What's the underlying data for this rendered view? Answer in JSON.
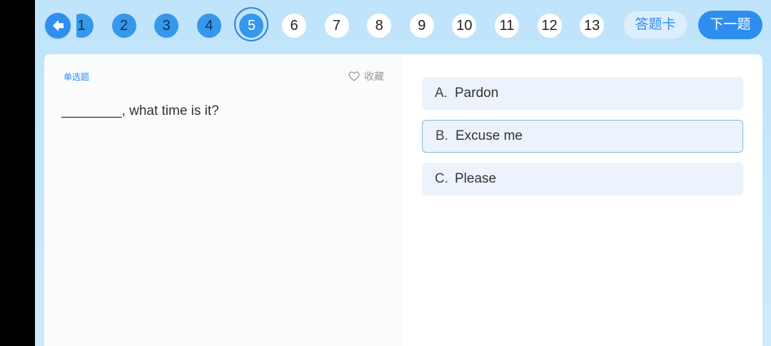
{
  "nav": {
    "back_icon": "arrow-left-icon",
    "question_numbers": [
      "1",
      "2",
      "3",
      "4",
      "5",
      "6",
      "7",
      "8",
      "9",
      "10",
      "11",
      "12",
      "13"
    ],
    "current_question": "5",
    "answered_questions": [
      "1",
      "2",
      "3",
      "4"
    ],
    "answer_card_label": "答题卡",
    "next_label": "下一题"
  },
  "question": {
    "type_label": "单选题",
    "favorite_label": "收藏",
    "text": "________, what time is it?",
    "options": [
      {
        "letter": "A.",
        "text": "Pardon",
        "selected": false
      },
      {
        "letter": "B.",
        "text": "Excuse me",
        "selected": true
      },
      {
        "letter": "C.",
        "text": "Please",
        "selected": false
      }
    ]
  },
  "colors": {
    "accent": "#2e8ef0",
    "answered": "#3797ea",
    "option_bg": "#edf3fd",
    "selected_border": "#7fb8e0"
  }
}
